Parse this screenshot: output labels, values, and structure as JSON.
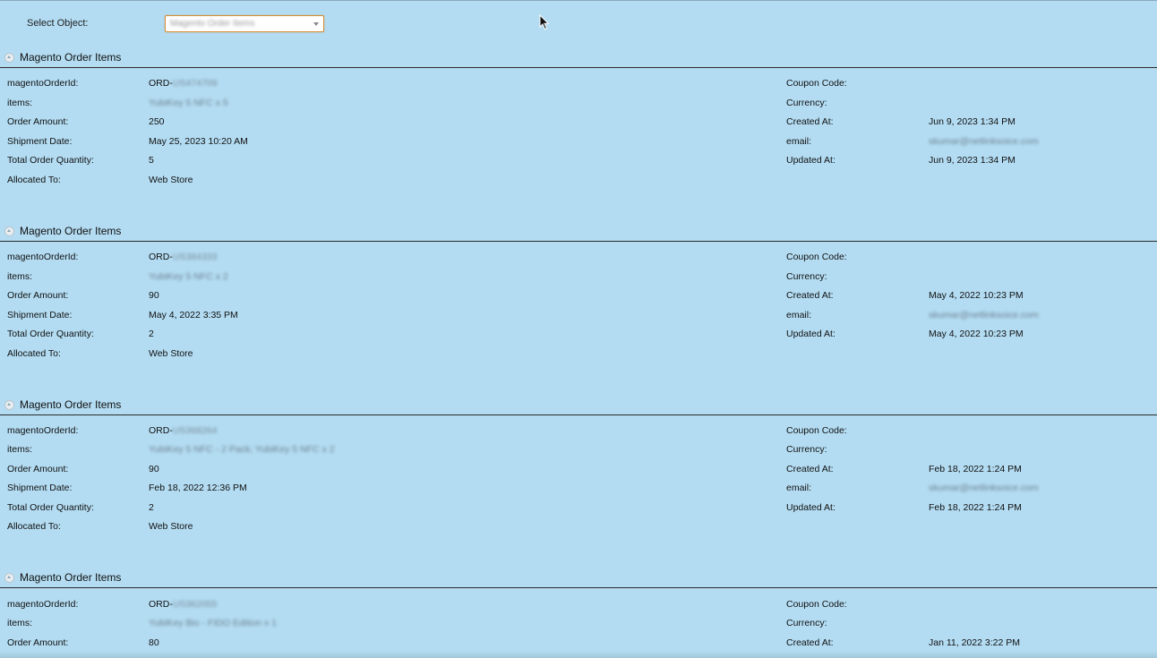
{
  "top": {
    "select_label": "Select Object:",
    "select_value": "Magento Order Items"
  },
  "sections": [
    {
      "title": "Magento Order Items",
      "labels": {
        "order_id": "magentoOrderId:",
        "items": "items:",
        "order_amount": "Order Amount:",
        "shipment_date": "Shipment Date:",
        "total_qty": "Total Order Quantity:",
        "allocated_to": "Allocated To:",
        "coupon_code": "Coupon Code:",
        "currency": "Currency:",
        "created_at": "Created At:",
        "email": "email:",
        "updated_at": "Updated At:"
      },
      "values": {
        "order_id_prefix": "ORD-",
        "order_id_suffix": "US474709",
        "items": "YubiKey 5 NFC x 5",
        "order_amount": "250",
        "shipment_date": "May 25, 2023 10:20 AM",
        "total_qty": "5",
        "allocated_to": "Web Store",
        "coupon_code": "",
        "currency": "",
        "created_at": "Jun 9, 2023 1:34 PM",
        "email": "skumar@netlinksoice.com",
        "updated_at": "Jun 9, 2023 1:34 PM"
      }
    },
    {
      "title": "Magento Order Items",
      "labels": {
        "order_id": "magentoOrderId:",
        "items": "items:",
        "order_amount": "Order Amount:",
        "shipment_date": "Shipment Date:",
        "total_qty": "Total Order Quantity:",
        "allocated_to": "Allocated To:",
        "coupon_code": "Coupon Code:",
        "currency": "Currency:",
        "created_at": "Created At:",
        "email": "email:",
        "updated_at": "Updated At:"
      },
      "values": {
        "order_id_prefix": "ORD-",
        "order_id_suffix": "US384333",
        "items": "YubiKey 5 NFC x 2",
        "order_amount": "90",
        "shipment_date": "May 4, 2022 3:35 PM",
        "total_qty": "2",
        "allocated_to": "Web Store",
        "coupon_code": "",
        "currency": "",
        "created_at": "May 4, 2022 10:23 PM",
        "email": "skumar@netlinksoice.com",
        "updated_at": "May 4, 2022 10:23 PM"
      }
    },
    {
      "title": "Magento Order Items",
      "labels": {
        "order_id": "magentoOrderId:",
        "items": "items:",
        "order_amount": "Order Amount:",
        "shipment_date": "Shipment Date:",
        "total_qty": "Total Order Quantity:",
        "allocated_to": "Allocated To:",
        "coupon_code": "Coupon Code:",
        "currency": "Currency:",
        "created_at": "Created At:",
        "email": "email:",
        "updated_at": "Updated At:"
      },
      "values": {
        "order_id_prefix": "ORD-",
        "order_id_suffix": "US368264",
        "items": "YubiKey 5 NFC - 2 Pack; YubiKey 5 NFC x 2",
        "order_amount": "90",
        "shipment_date": "Feb 18, 2022 12:36 PM",
        "total_qty": "2",
        "allocated_to": "Web Store",
        "coupon_code": "",
        "currency": "",
        "created_at": "Feb 18, 2022 1:24 PM",
        "email": "skumar@netlinksoice.com",
        "updated_at": "Feb 18, 2022 1:24 PM"
      }
    },
    {
      "title": "Magento Order Items",
      "labels": {
        "order_id": "magentoOrderId:",
        "items": "items:",
        "order_amount": "Order Amount:",
        "coupon_code": "Coupon Code:",
        "currency": "Currency:",
        "created_at": "Created At:"
      },
      "values": {
        "order_id_prefix": "ORD-",
        "order_id_suffix": "US362055",
        "items": "YubiKey Bio - FIDO Edition x 1",
        "order_amount": "80",
        "coupon_code": "",
        "currency": "",
        "created_at": "Jan 11, 2022 3:22 PM"
      }
    }
  ]
}
